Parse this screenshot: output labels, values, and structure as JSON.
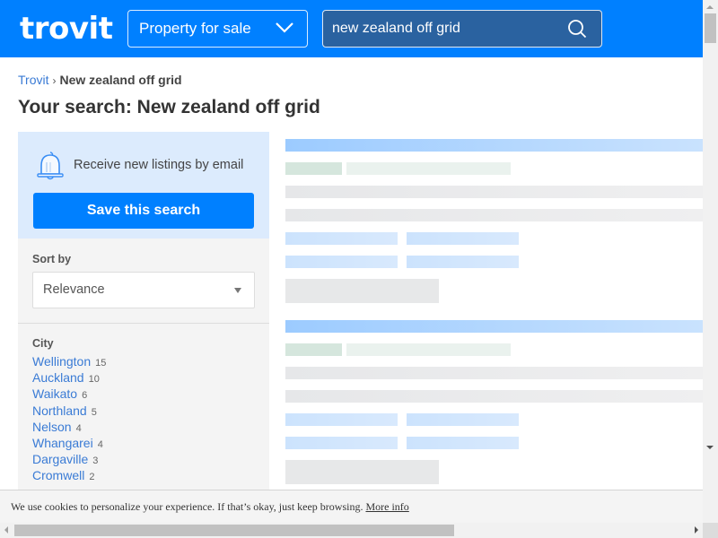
{
  "header": {
    "logo": "trovit",
    "property_type": "Property for sale",
    "search_value": "new zealand off grid",
    "brand_color": "#0080ff"
  },
  "breadcrumb": {
    "home": "Trovit",
    "separator": "›",
    "current": "New zealand off grid"
  },
  "page_title": "Your search: New zealand off grid",
  "sidebar": {
    "alert_text": "Receive new listings by email",
    "save_button": "Save this search",
    "sort_label": "Sort by",
    "sort_value": "Relevance",
    "city_label": "City",
    "cities": [
      {
        "name": "Wellington",
        "count": "15"
      },
      {
        "name": "Auckland",
        "count": "10"
      },
      {
        "name": "Waikato",
        "count": "6"
      },
      {
        "name": "Northland",
        "count": "5"
      },
      {
        "name": "Nelson",
        "count": "4"
      },
      {
        "name": "Whangarei",
        "count": "4"
      },
      {
        "name": "Dargaville",
        "count": "3"
      },
      {
        "name": "Cromwell",
        "count": "2"
      }
    ]
  },
  "cookie_bar": {
    "text": "We use cookies to personalize your experience. If that’s okay, just keep browsing.",
    "link": "More info"
  }
}
